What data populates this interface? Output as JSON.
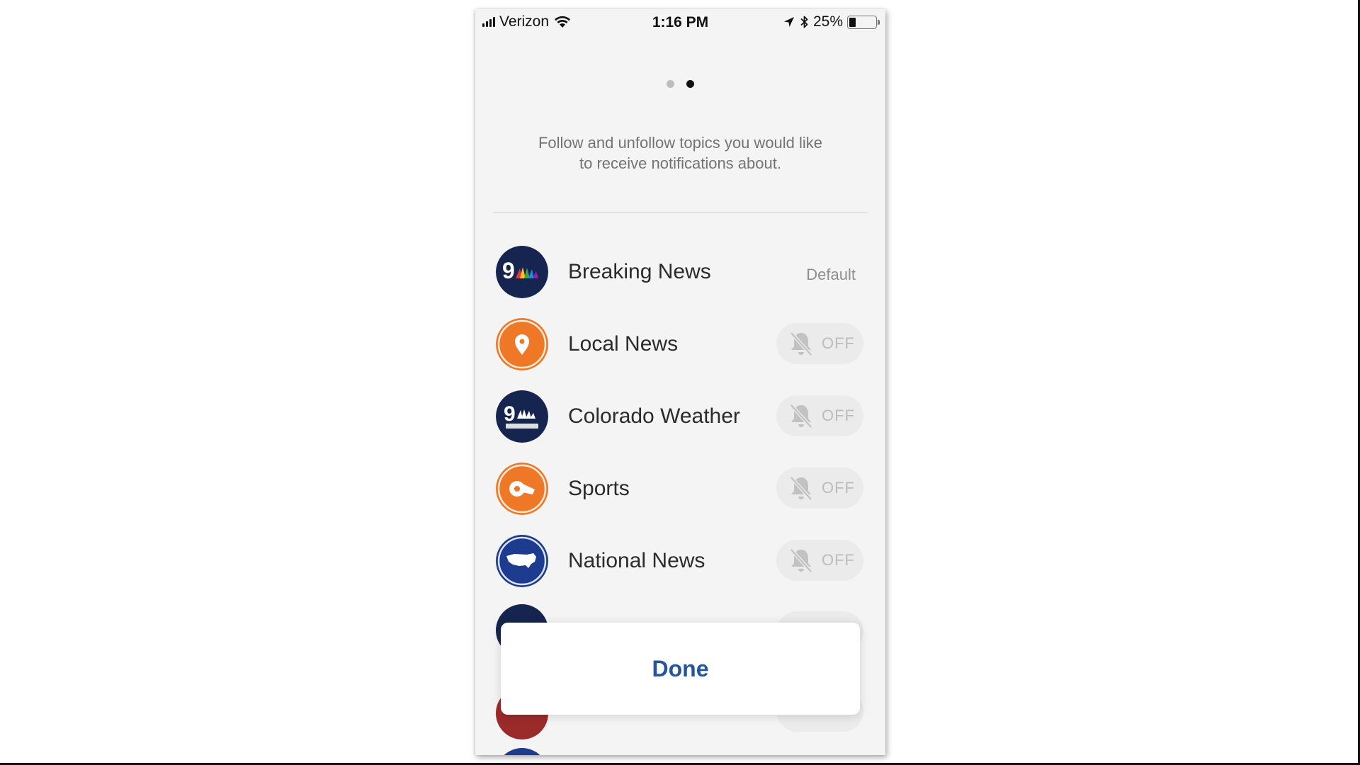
{
  "status_bar": {
    "carrier": "Verizon",
    "time": "1:16 PM",
    "battery": "25%",
    "battery_level": 0.25
  },
  "onboarding": {
    "page_count": 2,
    "active_page": 2,
    "intro_line1": "Follow and unfollow topics you would like",
    "intro_line2": "to receive notifications about."
  },
  "topics": [
    {
      "name": "Breaking News",
      "status": "Default",
      "icon": "9news-logo-icon",
      "color": "#16254f"
    },
    {
      "name": "Local News",
      "toggle": "OFF",
      "icon": "location-pin-icon",
      "color": "#ef7826"
    },
    {
      "name": "Colorado Weather",
      "toggle": "OFF",
      "icon": "9news-weather-logo-icon",
      "color": "#16254f"
    },
    {
      "name": "Sports",
      "toggle": "OFF",
      "icon": "whistle-icon",
      "color": "#ef7826"
    },
    {
      "name": "National News",
      "toggle": "OFF",
      "icon": "usa-map-icon",
      "color": "#1d3c8f"
    }
  ],
  "done_button": {
    "label": "Done",
    "color": "#25569c"
  },
  "colors": {
    "background": "#f4f4f4",
    "toggle_bg": "#ebebeb",
    "toggle_text": "#bcbcbc",
    "peek_red": "#9b2a2a"
  }
}
